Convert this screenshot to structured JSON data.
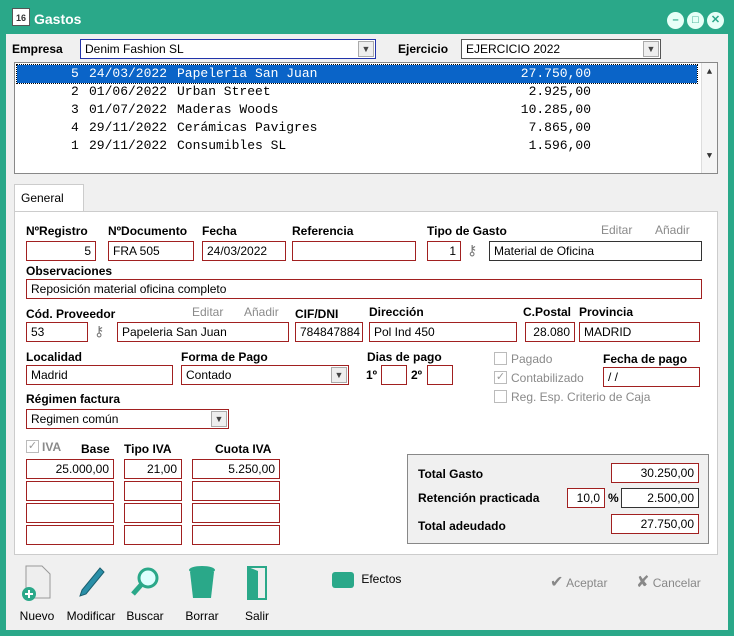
{
  "window": {
    "title": "Gastos",
    "icon_text": "16"
  },
  "header": {
    "empresa_label": "Empresa",
    "empresa_value": "Denim Fashion SL",
    "ejercicio_label": "Ejercicio",
    "ejercicio_value": "EJERCICIO 2022"
  },
  "list": [
    {
      "n": "5",
      "fecha": "24/03/2022",
      "nombre": "Papeleria San Juan",
      "importe": "27.750,00"
    },
    {
      "n": "2",
      "fecha": "01/06/2022",
      "nombre": "Urban Street",
      "importe": "2.925,00"
    },
    {
      "n": "3",
      "fecha": "01/07/2022",
      "nombre": "Maderas Woods",
      "importe": "10.285,00"
    },
    {
      "n": "4",
      "fecha": "29/11/2022",
      "nombre": "Cerámicas Pavigres",
      "importe": "7.865,00"
    },
    {
      "n": "1",
      "fecha": "29/11/2022",
      "nombre": "Consumibles SL",
      "importe": "1.596,00"
    }
  ],
  "tab": {
    "label": "General"
  },
  "form": {
    "nregistro_label": "NºRegistro",
    "nregistro": "5",
    "ndocumento_label": "NºDocumento",
    "ndocumento": "FRA 505",
    "fecha_label": "Fecha",
    "fecha": "24/03/2022",
    "referencia_label": "Referencia",
    "referencia": "",
    "tipo_gasto_label": "Tipo de Gasto",
    "tipo_gasto_code": "1",
    "tipo_gasto": "Material de Oficina",
    "editar": "Editar",
    "anadir": "Añadir",
    "observaciones_label": "Observaciones",
    "observaciones": "Reposición material oficina completo",
    "cod_proveedor_label": "Cód. Proveedor",
    "cod_proveedor": "53",
    "proveedor": "Papeleria San Juan",
    "cif_label": "CIF/DNI",
    "cif": "784847884",
    "direccion_label": "Dirección",
    "direccion": "Pol Ind 450",
    "cpostal_label": "C.Postal",
    "cpostal": "28.080",
    "provincia_label": "Provincia",
    "provincia": "MADRID",
    "localidad_label": "Localidad",
    "localidad": "Madrid",
    "forma_pago_label": "Forma de Pago",
    "forma_pago": "Contado",
    "dias_pago_label": "Dias de pago",
    "dia1": "1º",
    "dia2": "2º",
    "pagado_label": "Pagado",
    "contabilizado_label": "Contabilizado",
    "reg_esp_label": "Reg. Esp. Criterio de Caja",
    "fecha_pago_label": "Fecha de pago",
    "fecha_pago": " / /",
    "regimen_label": "Régimen factura",
    "regimen": "Regimen común",
    "iva_label": "IVA",
    "base_label": "Base",
    "tipo_iva_label": "Tipo IVA",
    "cuota_iva_label": "Cuota IVA",
    "base1": "25.000,00",
    "tipo1": "21,00",
    "cuota1": "5.250,00"
  },
  "totals": {
    "total_gasto_label": "Total Gasto",
    "total_gasto": "30.250,00",
    "retencion_label": "Retención practicada",
    "retencion_pct": "10,0",
    "pct_sign": "%",
    "retencion": "2.500,00",
    "total_adeudado_label": "Total adeudado",
    "total_adeudado": "27.750,00"
  },
  "toolbar": {
    "nuevo": "Nuevo",
    "modificar": "Modificar",
    "buscar": "Buscar",
    "borrar": "Borrar",
    "salir": "Salir",
    "efectos": "Efectos",
    "aceptar": "Aceptar",
    "cancelar": "Cancelar"
  },
  "colors": {
    "titlebar": "#2aa889",
    "selection": "#0a64c8",
    "field_border": "#a12020"
  }
}
